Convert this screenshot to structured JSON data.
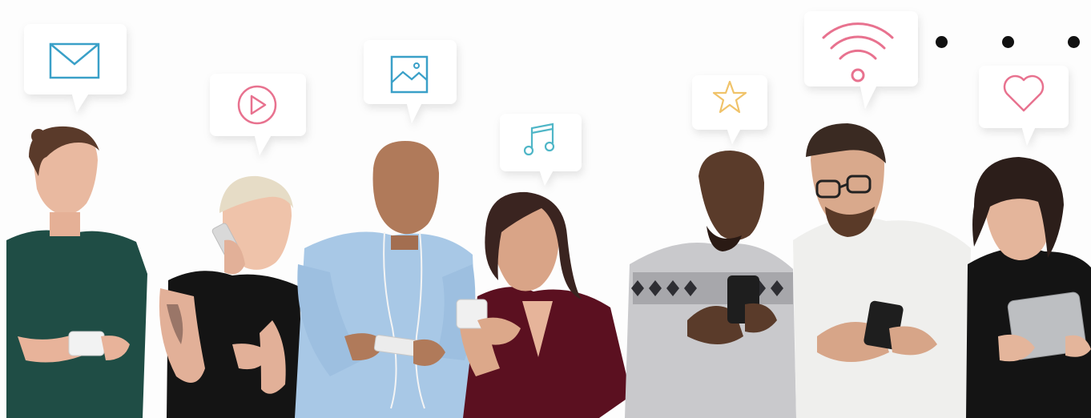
{
  "scene": {
    "description_icons": [
      "mail-icon",
      "play-icon",
      "image-icon",
      "music-note-icon",
      "star-icon",
      "wifi-icon",
      "heart-icon"
    ],
    "colors": {
      "mail": "#3aa0c8",
      "play": "#e8728f",
      "image": "#3aa0c8",
      "music": "#4fb6c7",
      "star": "#f0c36a",
      "wifi": "#e8728f",
      "heart": "#e8728f",
      "more_dots": "#111111"
    }
  },
  "more_menu": {
    "icon": "more-dots-icon"
  }
}
